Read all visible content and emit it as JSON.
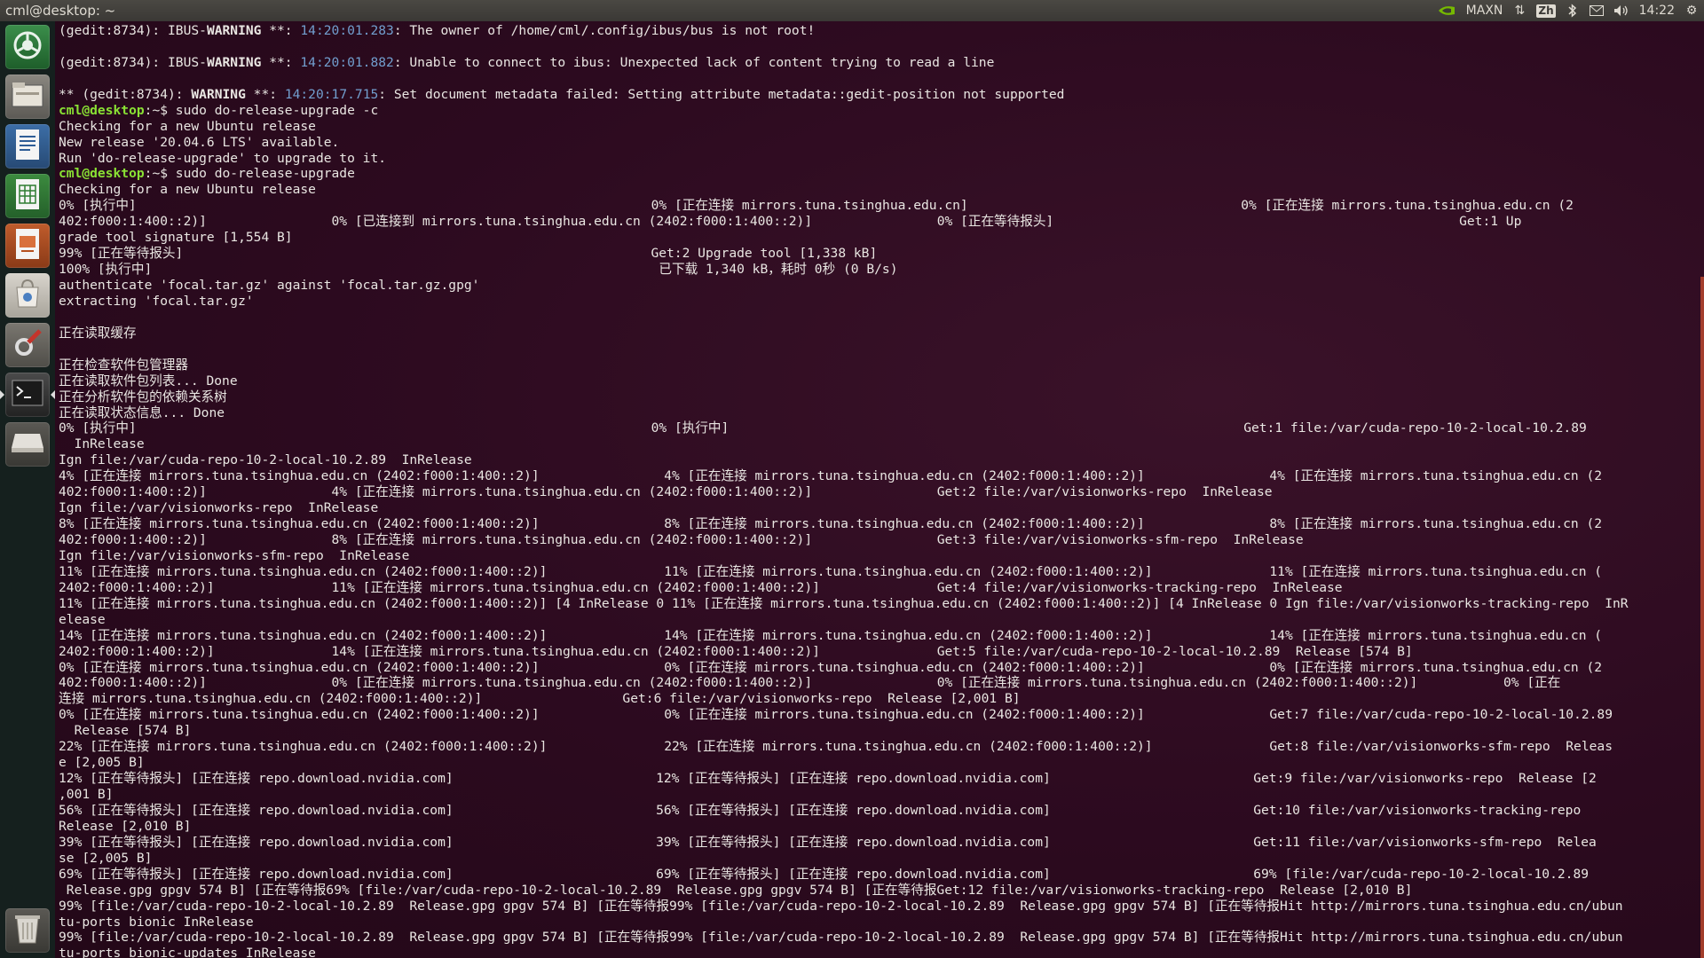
{
  "topbar": {
    "title": "cml@desktop: ~",
    "mode": "MAXN",
    "input_method": "Zh",
    "clock": "14:22"
  },
  "launcher": {
    "items": [
      {
        "name": "chromium-icon",
        "active": false
      },
      {
        "name": "files-icon",
        "active": false
      },
      {
        "name": "writer-icon",
        "active": false
      },
      {
        "name": "calc-icon",
        "active": false
      },
      {
        "name": "impress-icon",
        "active": false
      },
      {
        "name": "software-center-icon",
        "active": false
      },
      {
        "name": "settings-icon",
        "active": false
      },
      {
        "name": "terminal-icon",
        "active": true
      },
      {
        "name": "drive-icon",
        "active": false
      },
      {
        "name": "trash-icon",
        "active": false
      }
    ]
  },
  "terminal": {
    "lines": [
      {
        "type": "warn",
        "pre": "(gedit:8734): IBUS-",
        "kw": "WARNING",
        "mid": " **: ",
        "time": "14:20:01.283",
        "post": ": The owner of /home/cml/.config/ibus/bus is not root!"
      },
      {
        "type": "text",
        "text": ""
      },
      {
        "type": "warn",
        "pre": "(gedit:8734): IBUS-",
        "kw": "WARNING",
        "mid": " **: ",
        "time": "14:20:01.882",
        "post": ": Unable to connect to ibus: Unexpected lack of content trying to read a line"
      },
      {
        "type": "text",
        "text": ""
      },
      {
        "type": "warn",
        "pre": "** (gedit:8734): ",
        "kw": "WARNING",
        "mid": " **: ",
        "time": "14:20:17.715",
        "post": ": Set document metadata failed: Setting attribute metadata::gedit-position not supported"
      },
      {
        "type": "prompt",
        "prompt": "cml@desktop",
        "path": ":~$",
        "cmd": " sudo do-release-upgrade -c"
      },
      {
        "type": "text",
        "text": "Checking for a new Ubuntu release"
      },
      {
        "type": "text",
        "text": "New release '20.04.6 LTS' available."
      },
      {
        "type": "text",
        "text": "Run 'do-release-upgrade' to upgrade to it."
      },
      {
        "type": "prompt",
        "prompt": "cml@desktop",
        "path": ":~$",
        "cmd": " sudo do-release-upgrade"
      },
      {
        "type": "text",
        "text": "Checking for a new Ubuntu release"
      },
      {
        "type": "text",
        "text": "0% [执行中]                                                                  0% [正在连接 mirrors.tuna.tsinghua.edu.cn]                                   0% [正在连接 mirrors.tuna.tsinghua.edu.cn (2"
      },
      {
        "type": "text",
        "text": "402:f000:1:400::2)]                0% [已连接到 mirrors.tuna.tsinghua.edu.cn (2402:f000:1:400::2)]                0% [正在等待报头]                                                    Get:1 Up"
      },
      {
        "type": "text",
        "text": "grade tool signature [1,554 B]"
      },
      {
        "type": "text",
        "text": "99% [正在等待报头]                                                            Get:2 Upgrade tool [1,338 kB]"
      },
      {
        "type": "text",
        "text": "100% [执行中]                                                                 已下载 1,340 kB，耗时 0秒 (0 B/s)"
      },
      {
        "type": "text",
        "text": "authenticate 'focal.tar.gz' against 'focal.tar.gz.gpg'"
      },
      {
        "type": "text",
        "text": "extracting 'focal.tar.gz'"
      },
      {
        "type": "text",
        "text": ""
      },
      {
        "type": "text",
        "text": "正在读取缓存"
      },
      {
        "type": "text",
        "text": ""
      },
      {
        "type": "text",
        "text": "正在检查软件包管理器"
      },
      {
        "type": "text",
        "text": "正在读取软件包列表... Done"
      },
      {
        "type": "text",
        "text": "正在分析软件包的依赖关系树"
      },
      {
        "type": "text",
        "text": "正在读取状态信息... Done"
      },
      {
        "type": "text",
        "text": "0% [执行中]                                                                  0% [执行中]                                                                  Get:1 file:/var/cuda-repo-10-2-local-10.2.89"
      },
      {
        "type": "text",
        "text": "  InRelease"
      },
      {
        "type": "text",
        "text": "Ign file:/var/cuda-repo-10-2-local-10.2.89  InRelease"
      },
      {
        "type": "text",
        "text": "4% [正在连接 mirrors.tuna.tsinghua.edu.cn (2402:f000:1:400::2)]                4% [正在连接 mirrors.tuna.tsinghua.edu.cn (2402:f000:1:400::2)]                4% [正在连接 mirrors.tuna.tsinghua.edu.cn (2"
      },
      {
        "type": "text",
        "text": "402:f000:1:400::2)]                4% [正在连接 mirrors.tuna.tsinghua.edu.cn (2402:f000:1:400::2)]                Get:2 file:/var/visionworks-repo  InRelease"
      },
      {
        "type": "text",
        "text": "Ign file:/var/visionworks-repo  InRelease"
      },
      {
        "type": "text",
        "text": "8% [正在连接 mirrors.tuna.tsinghua.edu.cn (2402:f000:1:400::2)]                8% [正在连接 mirrors.tuna.tsinghua.edu.cn (2402:f000:1:400::2)]                8% [正在连接 mirrors.tuna.tsinghua.edu.cn (2"
      },
      {
        "type": "text",
        "text": "402:f000:1:400::2)]                8% [正在连接 mirrors.tuna.tsinghua.edu.cn (2402:f000:1:400::2)]                Get:3 file:/var/visionworks-sfm-repo  InRelease"
      },
      {
        "type": "text",
        "text": "Ign file:/var/visionworks-sfm-repo  InRelease"
      },
      {
        "type": "text",
        "text": "11% [正在连接 mirrors.tuna.tsinghua.edu.cn (2402:f000:1:400::2)]               11% [正在连接 mirrors.tuna.tsinghua.edu.cn (2402:f000:1:400::2)]               11% [正在连接 mirrors.tuna.tsinghua.edu.cn ("
      },
      {
        "type": "text",
        "text": "2402:f000:1:400::2)]               11% [正在连接 mirrors.tuna.tsinghua.edu.cn (2402:f000:1:400::2)]               Get:4 file:/var/visionworks-tracking-repo  InRelease"
      },
      {
        "type": "text",
        "text": "11% [正在连接 mirrors.tuna.tsinghua.edu.cn (2402:f000:1:400::2)] [4 InRelease 0 11% [正在连接 mirrors.tuna.tsinghua.edu.cn (2402:f000:1:400::2)] [4 InRelease 0 Ign file:/var/visionworks-tracking-repo  InR"
      },
      {
        "type": "text",
        "text": "elease"
      },
      {
        "type": "text",
        "text": "14% [正在连接 mirrors.tuna.tsinghua.edu.cn (2402:f000:1:400::2)]               14% [正在连接 mirrors.tuna.tsinghua.edu.cn (2402:f000:1:400::2)]               14% [正在连接 mirrors.tuna.tsinghua.edu.cn ("
      },
      {
        "type": "text",
        "text": "2402:f000:1:400::2)]               14% [正在连接 mirrors.tuna.tsinghua.edu.cn (2402:f000:1:400::2)]               Get:5 file:/var/cuda-repo-10-2-local-10.2.89  Release [574 B]"
      },
      {
        "type": "text",
        "text": "0% [正在连接 mirrors.tuna.tsinghua.edu.cn (2402:f000:1:400::2)]                0% [正在连接 mirrors.tuna.tsinghua.edu.cn (2402:f000:1:400::2)]                0% [正在连接 mirrors.tuna.tsinghua.edu.cn (2"
      },
      {
        "type": "text",
        "text": "402:f000:1:400::2)]                0% [正在连接 mirrors.tuna.tsinghua.edu.cn (2402:f000:1:400::2)]                0% [正在连接 mirrors.tuna.tsinghua.edu.cn (2402:f000:1:400::2)]           0% [正在"
      },
      {
        "type": "text",
        "text": "连接 mirrors.tuna.tsinghua.edu.cn (2402:f000:1:400::2)]                  Get:6 file:/var/visionworks-repo  Release [2,001 B]"
      },
      {
        "type": "text",
        "text": "0% [正在连接 mirrors.tuna.tsinghua.edu.cn (2402:f000:1:400::2)]                0% [正在连接 mirrors.tuna.tsinghua.edu.cn (2402:f000:1:400::2)]                Get:7 file:/var/cuda-repo-10-2-local-10.2.89"
      },
      {
        "type": "text",
        "text": "  Release [574 B]"
      },
      {
        "type": "text",
        "text": "22% [正在连接 mirrors.tuna.tsinghua.edu.cn (2402:f000:1:400::2)]               22% [正在连接 mirrors.tuna.tsinghua.edu.cn (2402:f000:1:400::2)]               Get:8 file:/var/visionworks-sfm-repo  Releas"
      },
      {
        "type": "text",
        "text": "e [2,005 B]"
      },
      {
        "type": "text",
        "text": "12% [正在等待报头] [正在连接 repo.download.nvidia.com]                          12% [正在等待报头] [正在连接 repo.download.nvidia.com]                          Get:9 file:/var/visionworks-repo  Release [2"
      },
      {
        "type": "text",
        "text": ",001 B]"
      },
      {
        "type": "text",
        "text": "56% [正在等待报头] [正在连接 repo.download.nvidia.com]                          56% [正在等待报头] [正在连接 repo.download.nvidia.com]                          Get:10 file:/var/visionworks-tracking-repo"
      },
      {
        "type": "text",
        "text": "Release [2,010 B]"
      },
      {
        "type": "text",
        "text": "39% [正在等待报头] [正在连接 repo.download.nvidia.com]                          39% [正在等待报头] [正在连接 repo.download.nvidia.com]                          Get:11 file:/var/visionworks-sfm-repo  Relea"
      },
      {
        "type": "text",
        "text": "se [2,005 B]"
      },
      {
        "type": "text",
        "text": "69% [正在等待报头] [正在连接 repo.download.nvidia.com]                          69% [正在等待报头] [正在连接 repo.download.nvidia.com]                          69% [file:/var/cuda-repo-10-2-local-10.2.89"
      },
      {
        "type": "text",
        "text": " Release.gpg gpgv 574 B] [正在等待报69% [file:/var/cuda-repo-10-2-local-10.2.89  Release.gpg gpgv 574 B] [正在等待报Get:12 file:/var/visionworks-tracking-repo  Release [2,010 B]"
      },
      {
        "type": "text",
        "text": "99% [file:/var/cuda-repo-10-2-local-10.2.89  Release.gpg gpgv 574 B] [正在等待报99% [file:/var/cuda-repo-10-2-local-10.2.89  Release.gpg gpgv 574 B] [正在等待报Hit http://mirrors.tuna.tsinghua.edu.cn/ubun"
      },
      {
        "type": "text",
        "text": "tu-ports bionic InRelease"
      },
      {
        "type": "text",
        "text": "99% [file:/var/cuda-repo-10-2-local-10.2.89  Release.gpg gpgv 574 B] [正在等待报99% [file:/var/cuda-repo-10-2-local-10.2.89  Release.gpg gpgv 574 B] [正在等待报Hit http://mirrors.tuna.tsinghua.edu.cn/ubun"
      },
      {
        "type": "text",
        "text": "tu-ports bionic-updates InRelease"
      }
    ]
  }
}
